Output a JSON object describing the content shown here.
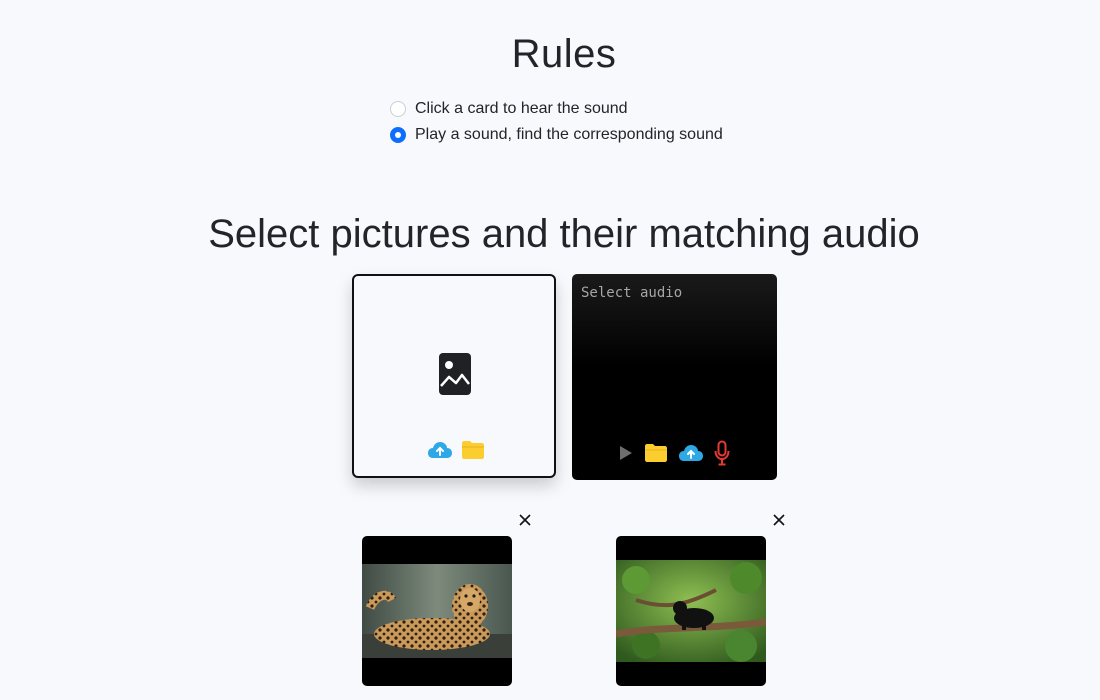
{
  "rules": {
    "title": "Rules",
    "options": [
      {
        "label": "Click a card to hear the sound",
        "checked": false
      },
      {
        "label": "Play a sound, find the corresponding sound",
        "checked": true
      }
    ]
  },
  "selection": {
    "title": "Select pictures and their matching audio",
    "image_card": {
      "placeholder_icon": "image-icon",
      "actions": [
        "cloud-upload-icon",
        "folder-icon"
      ]
    },
    "audio_card": {
      "label": "Select audio",
      "actions": [
        "play-icon",
        "folder-icon",
        "cloud-upload-icon",
        "microphone-icon"
      ]
    }
  },
  "uploaded_pictures": [
    {
      "subject": "leopard",
      "remove_icon": "close-icon"
    },
    {
      "subject": "black panther",
      "remove_icon": "close-icon"
    }
  ],
  "colors": {
    "background": "#f8f9fd",
    "radio_checked": "#0d6efd",
    "cloud_icon": "#2fa9e6",
    "folder_icon": "#fbcd2e",
    "mic_icon": "#e53935",
    "play_icon": "#6e6e6e"
  }
}
